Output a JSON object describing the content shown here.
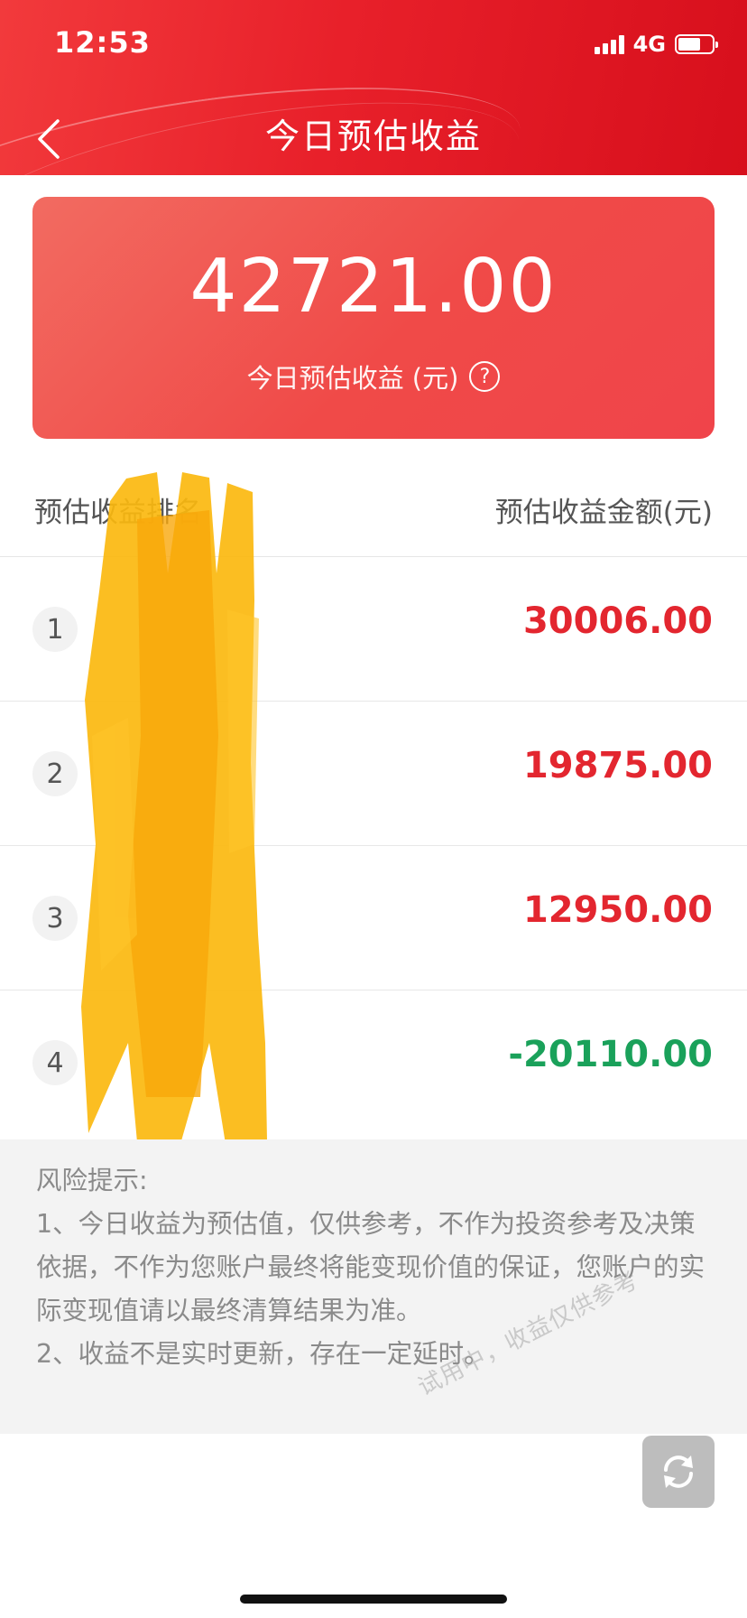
{
  "status_bar": {
    "time": "12:53",
    "network": "4G",
    "icons": [
      "signal-icon",
      "battery-icon"
    ]
  },
  "header": {
    "title": "今日预估收益",
    "back_icon": "chevron-left-icon",
    "background_color": "#e8202a"
  },
  "summary": {
    "amount": "42721.00",
    "label": "今日预估收益 (元)",
    "help_icon": "question-circle-icon",
    "help_glyph": "?"
  },
  "table": {
    "header_left": "预估收益排名",
    "header_right": "预估收益金额(元)",
    "rows": [
      {
        "rank": "1",
        "value": "30006.00",
        "sign": "positive"
      },
      {
        "rank": "2",
        "value": "19875.00",
        "sign": "positive"
      },
      {
        "rank": "3",
        "value": "12950.00",
        "sign": "positive"
      },
      {
        "rank": "4",
        "value": "-20110.00",
        "sign": "negative"
      }
    ],
    "positive_color": "#e3262f",
    "negative_color": "#1aa15a"
  },
  "notice": {
    "title": "风险提示:",
    "line1": "1、今日收益为预估值，仅供参考，不作为投资参考及决策依据，不作为您账户最终将能变现价值的保证，您账户的实际变现值请以最终清算结果为准。",
    "line2": "2、收益不是实时更新，存在一定延时。"
  },
  "watermark": "试用中，收益仅供参考",
  "refresh_icon": "refresh-icon"
}
